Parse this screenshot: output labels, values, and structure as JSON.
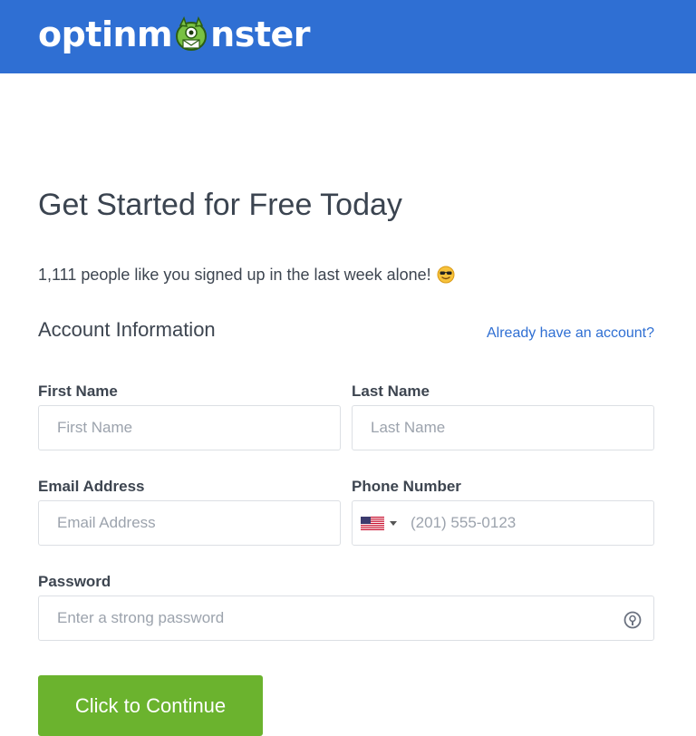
{
  "brand": {
    "name_prefix": "optinm",
    "name_suffix": "nster"
  },
  "page": {
    "title": "Get Started for Free Today",
    "social_proof": "1,111 people like you signed up in the last week alone!",
    "social_emoji": "sunglasses-face-emoji"
  },
  "section": {
    "heading": "Account Information",
    "login_link": "Already have an account?"
  },
  "form": {
    "first_name": {
      "label": "First Name",
      "placeholder": "First Name",
      "value": ""
    },
    "last_name": {
      "label": "Last Name",
      "placeholder": "Last Name",
      "value": ""
    },
    "email": {
      "label": "Email Address",
      "placeholder": "Email Address",
      "value": ""
    },
    "phone": {
      "label": "Phone Number",
      "placeholder": "(201) 555-0123",
      "value": "",
      "country_flag": "us-flag-icon"
    },
    "password": {
      "label": "Password",
      "placeholder": "Enter a strong password",
      "value": "",
      "icon": "password-manager-icon"
    },
    "submit_label": "Click to Continue"
  },
  "colors": {
    "header_bg": "#2f6fd3",
    "link": "#2f6fd3",
    "button_bg": "#6bb32e",
    "text": "#3d4550",
    "border": "#dcdfe4"
  }
}
